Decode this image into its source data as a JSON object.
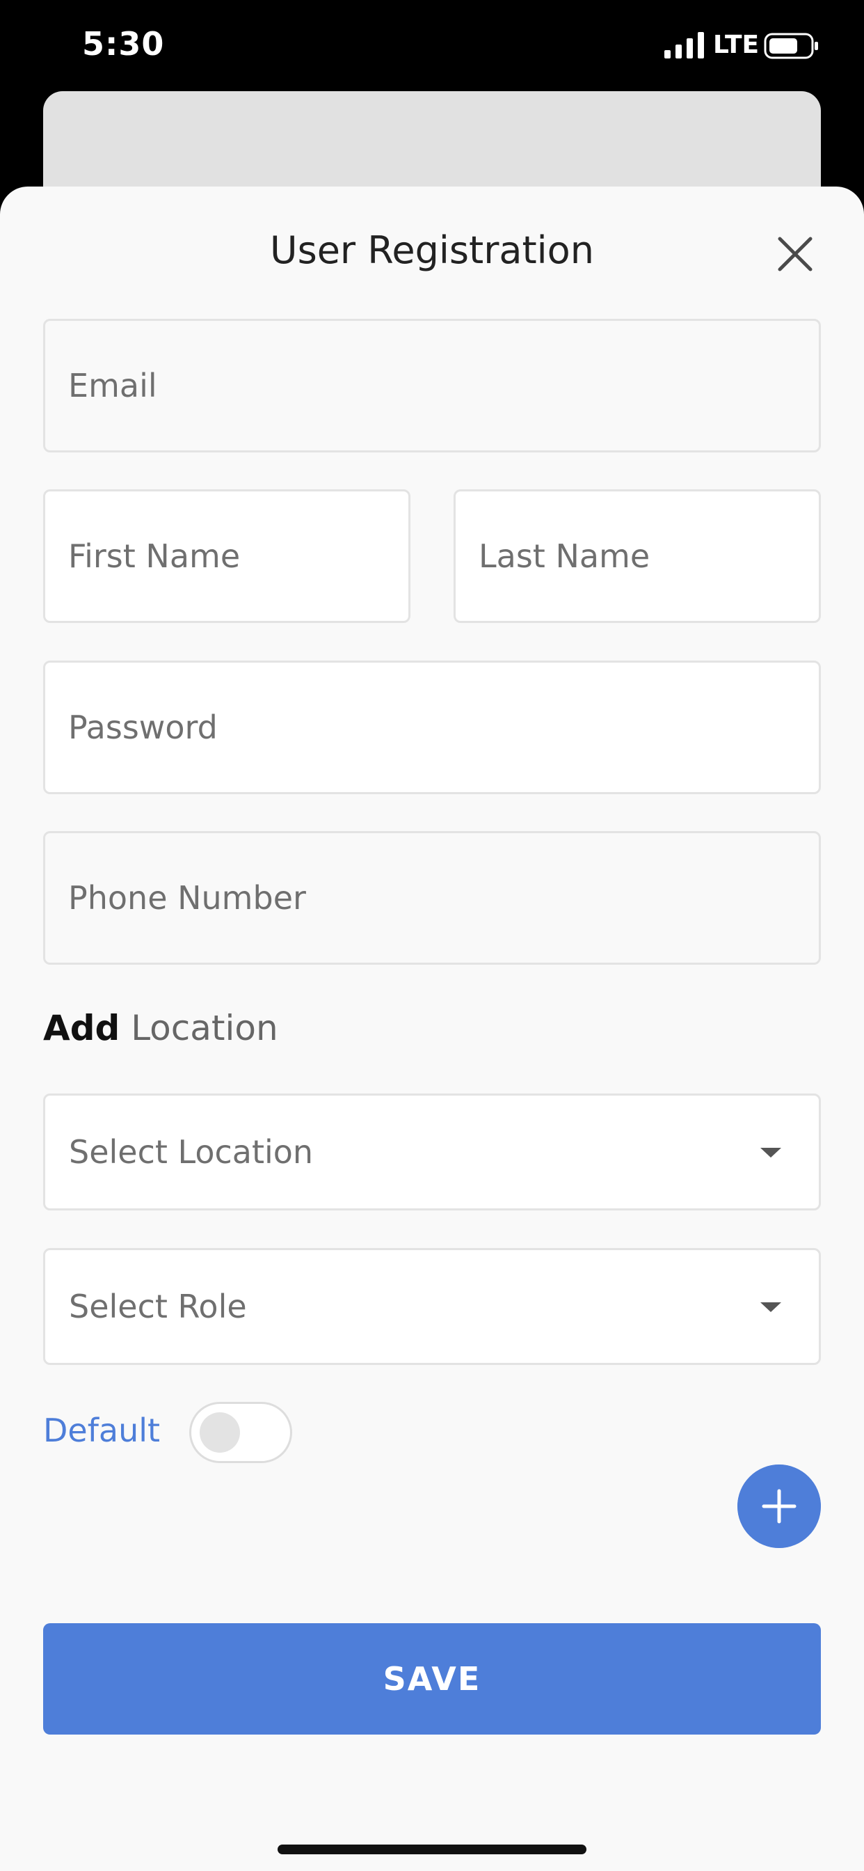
{
  "status_bar": {
    "time": "5:30",
    "network": "LTE",
    "signal_icon": "cellular-signal-icon",
    "battery_icon": "battery-icon"
  },
  "sheet": {
    "title": "User Registration",
    "close_icon": "close-icon"
  },
  "form": {
    "email_placeholder": "Email",
    "first_name_placeholder": "First Name",
    "last_name_placeholder": "Last Name",
    "password_placeholder": "Password",
    "phone_placeholder": "Phone Number"
  },
  "location_section": {
    "heading_strong": "Add",
    "heading_light": "Location",
    "location_select": "Select Location",
    "role_select": "Select Role",
    "default_label": "Default",
    "default_on": false,
    "add_icon": "plus-icon"
  },
  "actions": {
    "save_label": "SAVE"
  },
  "colors": {
    "accent": "#4e7ed9",
    "sheet_background": "#f9f9f9",
    "status_bar_background": "#000000"
  }
}
